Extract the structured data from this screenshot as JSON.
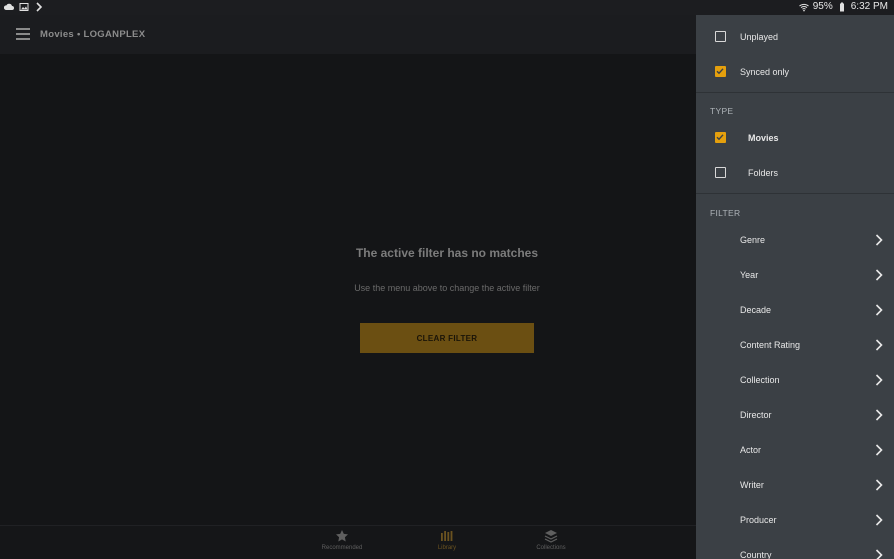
{
  "status_bar": {
    "battery": "95%",
    "time": "6:32 PM"
  },
  "app_bar": {
    "title": "Movies • LOGANPLEX"
  },
  "empty_state": {
    "title": "The active filter has no matches",
    "subtitle": "Use the menu above to change the active filter",
    "button_label": "CLEAR FILTER"
  },
  "bottom_nav": {
    "items": [
      {
        "label": "Recommended",
        "icon": "star-icon",
        "active": false
      },
      {
        "label": "Library",
        "icon": "library-bars-icon",
        "active": true
      },
      {
        "label": "Collections",
        "icon": "stack-layers-icon",
        "active": false
      }
    ]
  },
  "drawer": {
    "toggles": [
      {
        "label": "Unplayed",
        "checked": false
      },
      {
        "label": "Synced only",
        "checked": true
      }
    ],
    "type_header": "TYPE",
    "types": [
      {
        "label": "Movies",
        "checked": true
      },
      {
        "label": "Folders",
        "checked": false
      }
    ],
    "filter_header": "FILTER",
    "filters": [
      {
        "label": "Genre"
      },
      {
        "label": "Year"
      },
      {
        "label": "Decade"
      },
      {
        "label": "Content Rating"
      },
      {
        "label": "Collection"
      },
      {
        "label": "Director"
      },
      {
        "label": "Actor"
      },
      {
        "label": "Writer"
      },
      {
        "label": "Producer"
      },
      {
        "label": "Country"
      }
    ]
  },
  "colors": {
    "accent": "#e5a00d",
    "drawer_bg": "#3b4045",
    "main_bg": "#141517"
  }
}
